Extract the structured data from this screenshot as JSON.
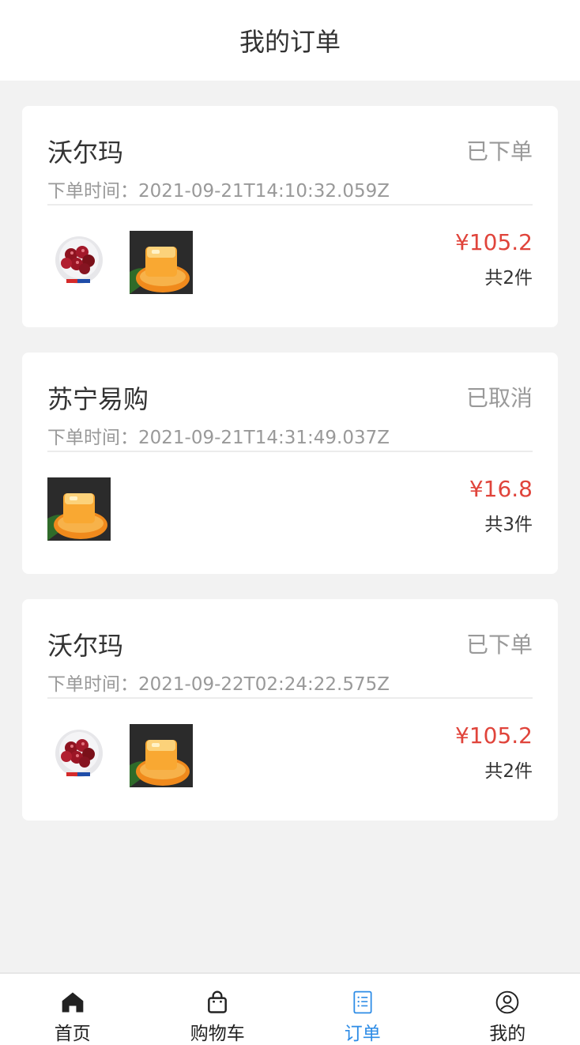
{
  "header": {
    "title": "我的订单"
  },
  "orders": [
    {
      "shop": "沃尔玛",
      "status": "已下单",
      "time_label": "下单时间：",
      "time": "2021-09-21T14:10:32.059Z",
      "price": "¥105.2",
      "count": "共2件",
      "products": [
        "cherry-product-image",
        "orange-product-image"
      ]
    },
    {
      "shop": "苏宁易购",
      "status": "已取消",
      "time_label": "下单时间：",
      "time": "2021-09-21T14:31:49.037Z",
      "price": "¥16.8",
      "count": "共3件",
      "products": [
        "orange-product-image"
      ]
    },
    {
      "shop": "沃尔玛",
      "status": "已下单",
      "time_label": "下单时间：",
      "time": "2021-09-22T02:24:22.575Z",
      "price": "¥105.2",
      "count": "共2件",
      "products": [
        "cherry-product-image",
        "orange-product-image"
      ]
    }
  ],
  "tabbar": {
    "items": [
      {
        "label": "首页",
        "icon": "home-icon",
        "active": false
      },
      {
        "label": "购物车",
        "icon": "shopping-bag-icon",
        "active": false
      },
      {
        "label": "订单",
        "icon": "order-list-icon",
        "active": true
      },
      {
        "label": "我的",
        "icon": "user-icon",
        "active": false
      }
    ]
  },
  "colors": {
    "price": "#e0443b",
    "status": "#999999",
    "active_tab": "#2e8ce6",
    "background": "#f2f2f2"
  }
}
